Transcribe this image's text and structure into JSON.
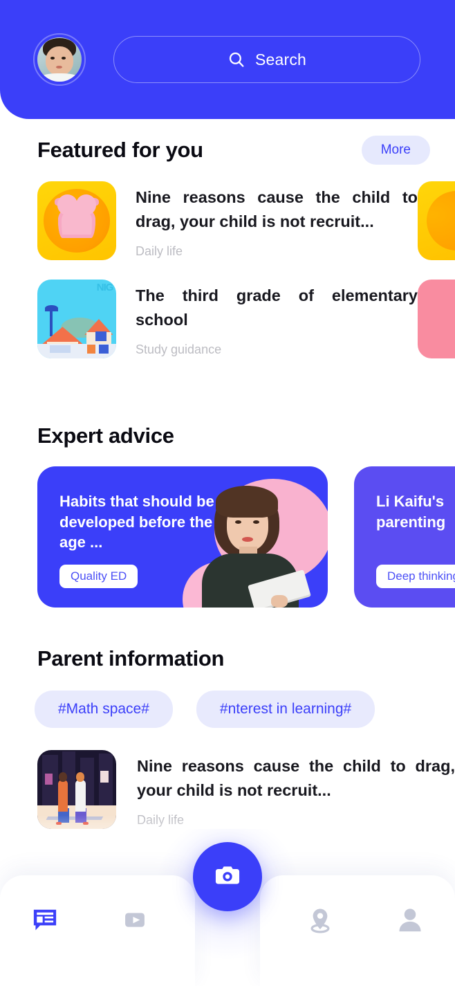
{
  "header": {
    "avatar_name": "user-avatar",
    "search": {
      "placeholder": "Search",
      "icon": "search-icon"
    }
  },
  "featured": {
    "title": "Featured for you",
    "more_label": "More",
    "items": [
      {
        "title": "Nine reasons cause the child to drag, your child is not recruit...",
        "category": "Daily life",
        "thumb": "alarm-clock-yellow"
      },
      {
        "title": "The third grade of elementary school",
        "category": "Study guidance",
        "thumb": "town-cyan"
      }
    ]
  },
  "expert": {
    "title": "Expert advice",
    "cards": [
      {
        "title": "Habits that should be developed before the age ...",
        "chip": "Quality ED",
        "color": "#3b3ff9"
      },
      {
        "title": "Li Kaifu's parenting",
        "chip": "Deep thinking",
        "color": "#5b4df2"
      }
    ]
  },
  "parent": {
    "title": "Parent information",
    "tags": [
      "#Math space#",
      "#nterest in learning#"
    ],
    "article": {
      "title": "Nine reasons cause the child to drag, your child is not recruit...",
      "category": "Daily life",
      "thumb": "night-street"
    }
  },
  "nav": {
    "items": [
      {
        "name": "news-icon",
        "active": true
      },
      {
        "name": "video-icon",
        "active": false
      },
      {
        "name": "location-icon",
        "active": false
      },
      {
        "name": "profile-icon",
        "active": false
      }
    ],
    "fab": {
      "name": "camera-icon"
    }
  },
  "colors": {
    "brand": "#3b3ff9",
    "brand_alt": "#5b4df2",
    "chip_bg": "#e8eafd",
    "muted_text": "#bcbcc2",
    "nav_inactive": "#c3c7d6"
  }
}
